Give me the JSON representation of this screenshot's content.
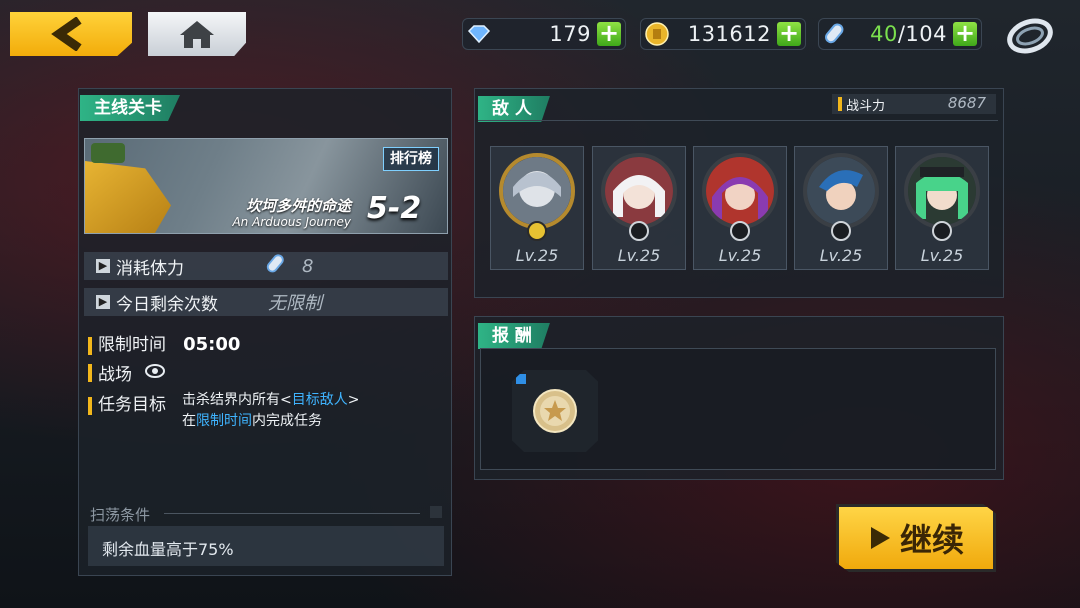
{
  "topbar": {
    "gems": "179",
    "coins": "131612",
    "stamina_current": "40",
    "stamina_sep": "/104"
  },
  "stage": {
    "section_title": "主线关卡",
    "ranking_label": "排行榜",
    "name_cn": "坎坷多舛的命途",
    "name_en": "An Arduous Journey",
    "number": "5-2",
    "cost_label": "消耗体力",
    "cost_value": "8",
    "remaining_label": "今日剩余次数",
    "remaining_value": "无限制",
    "time_limit_label": "限制时间",
    "time_limit_value": "05:00",
    "battlefield_label": "战场",
    "objective_label": "任务目标",
    "objective_line1_a": "击杀结界内所有<",
    "objective_line1_b": "目标敌人",
    "objective_line1_c": ">",
    "objective_line2_a": "在",
    "objective_line2_b": "限制时间",
    "objective_line2_c": "内完成任务",
    "sweep_title": "扫荡条件",
    "sweep_condition": "剩余血量高于75%"
  },
  "enemies": {
    "section_title": "敌 人",
    "power_label": "战斗力",
    "power_value": "8687",
    "list": [
      {
        "level": "Lv.25",
        "hair": "#b8c2cf",
        "bg": "#6e7a86"
      },
      {
        "level": "Lv.25",
        "hair": "#f2f2f4",
        "bg": "#8a3a3f"
      },
      {
        "level": "Lv.25",
        "hair": "#8a3bb0",
        "bg": "#b0352d"
      },
      {
        "level": "Lv.25",
        "hair": "#2a6fb8",
        "bg": "#3c4a58"
      },
      {
        "level": "Lv.25",
        "hair": "#48d38a",
        "bg": "#2b3a33"
      }
    ]
  },
  "rewards": {
    "section_title": "报 酬"
  },
  "continue_label": "继续"
}
